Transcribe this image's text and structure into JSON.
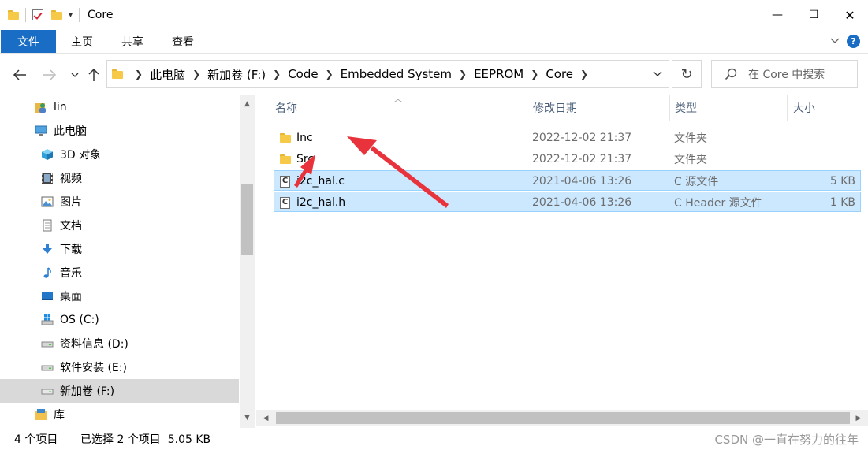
{
  "title": "Core",
  "ribbon": {
    "file": "文件",
    "home": "主页",
    "share": "共享",
    "view": "查看",
    "help": "?"
  },
  "window": {
    "minimize": "—",
    "maximize": "☐",
    "close": "✕"
  },
  "address": {
    "crumbs": [
      "此电脑",
      "新加卷 (F:)",
      "Code",
      "Embedded System",
      "EEPROM",
      "Core"
    ]
  },
  "search": {
    "placeholder": "在 Core 中搜索"
  },
  "sidebar": {
    "items": [
      {
        "label": "lin",
        "icon": "user-folder-icon"
      },
      {
        "label": "此电脑",
        "icon": "computer-icon"
      },
      {
        "label": "3D 对象",
        "icon": "3d-objects-icon"
      },
      {
        "label": "视频",
        "icon": "video-icon"
      },
      {
        "label": "图片",
        "icon": "pictures-icon"
      },
      {
        "label": "文档",
        "icon": "documents-icon"
      },
      {
        "label": "下载",
        "icon": "download-icon"
      },
      {
        "label": "音乐",
        "icon": "music-icon"
      },
      {
        "label": "桌面",
        "icon": "desktop-icon"
      },
      {
        "label": "OS (C:)",
        "icon": "windows-drive-icon"
      },
      {
        "label": "资料信息 (D:)",
        "icon": "drive-icon"
      },
      {
        "label": "软件安装 (E:)",
        "icon": "drive-icon"
      },
      {
        "label": "新加卷 (F:)",
        "icon": "drive-icon"
      },
      {
        "label": "库",
        "icon": "library-icon"
      }
    ]
  },
  "columns": {
    "name": "名称",
    "modified": "修改日期",
    "type": "类型",
    "size": "大小"
  },
  "files": [
    {
      "name": "Inc",
      "modified": "2022-12-02 21:37",
      "type": "文件夹",
      "size": "",
      "icon": "folder-icon"
    },
    {
      "name": "Src",
      "modified": "2022-12-02 21:37",
      "type": "文件夹",
      "size": "",
      "icon": "folder-icon"
    },
    {
      "name": "i2c_hal.c",
      "modified": "2021-04-06 13:26",
      "type": "C 源文件",
      "size": "5 KB",
      "icon": "c-file-icon"
    },
    {
      "name": "i2c_hal.h",
      "modified": "2021-04-06 13:26",
      "type": "C Header 源文件",
      "size": "1 KB",
      "icon": "c-file-icon"
    }
  ],
  "status": {
    "count": "4 个项目",
    "selected": "已选择 2 个项目  5.05 KB",
    "watermark": "CSDN @一直在努力的往年"
  },
  "colors": {
    "accent": "#1a6dc4",
    "selection": "#cce8ff",
    "annotation": "#e8333c"
  }
}
